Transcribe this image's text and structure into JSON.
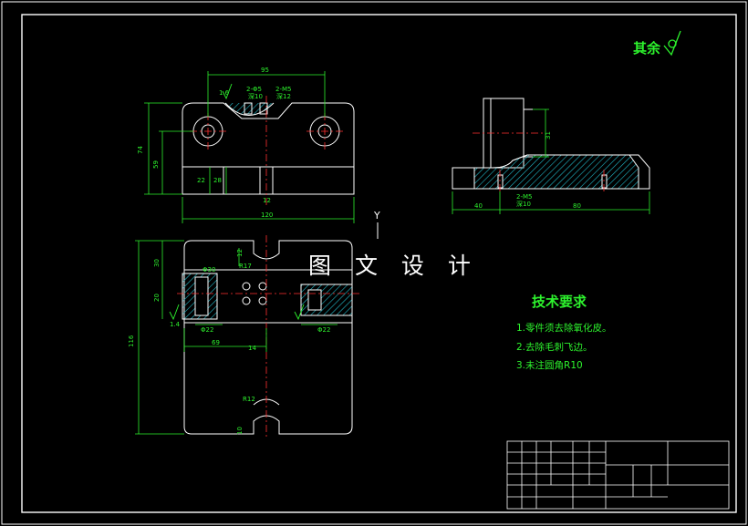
{
  "watermark": "图 文 设 计",
  "roughness_note": "其余",
  "tech_requirements": {
    "title": "技术要求",
    "items": [
      "1.零件须去除氧化皮。",
      "2.去除毛刺飞边。",
      "3.未注圆角R10"
    ]
  },
  "axis_label": "Y",
  "dims_top_view": {
    "d95": "95",
    "d74": "74",
    "d59": "59",
    "d120": "120",
    "d12": "12",
    "d22": "22",
    "d28": "28",
    "d1_6": "1.6",
    "hole_a": "2-Φ5",
    "hole_a2": "深10",
    "hole_b": "2-M5",
    "hole_b2": "深12"
  },
  "dims_side_view": {
    "d40": "40",
    "d80": "80",
    "d31": "31",
    "hole": "2-M5",
    "hole2": "深10"
  },
  "dims_front_view": {
    "d116": "116",
    "d30": "30",
    "d20": "20",
    "d12": "12",
    "d14": "14",
    "d69": "69",
    "d1_4": "1.4",
    "d30b": "Φ30",
    "d22": "Φ22",
    "d22b": "Φ22",
    "r17": "R17",
    "r12": "R12",
    "d10": "10"
  },
  "colors": {
    "outline": "#ffffff",
    "dimension": "#2df22d",
    "centerline": "#ff3030",
    "hatch": "#21b8c8",
    "frame": "#ffffff"
  }
}
